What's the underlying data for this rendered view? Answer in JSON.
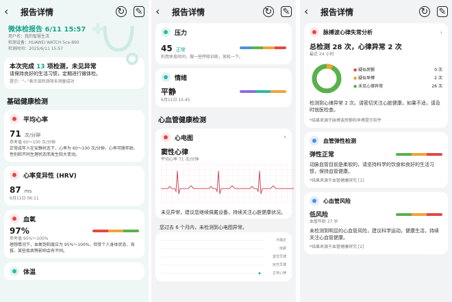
{
  "colors": {
    "accent": "#1aa38c",
    "red": "#e24747",
    "green": "#5ab04c",
    "orange": "#f2a33a",
    "purple": "#8d6be0",
    "blue": "#4a90e2"
  },
  "s1": {
    "title": "报告详情",
    "report_title": "微体检报告 6/11 15:57",
    "meta": [
      "用户名：我的智慧生活",
      "检测设备：HUAWEI WATCH 5ce-890",
      "检测时间：2025/6/11 15:57"
    ],
    "summary_prefix": "本次完成 ",
    "summary_count": "13",
    "summary_suffix": " 项检测，未见异常",
    "summary_sub": "请保持良好的生活习惯，定期进行微体检。",
    "note": "提示：“--”表示该检测项未测量成功",
    "section": "基础健康检测",
    "hr": {
      "label": "平均心率",
      "value": "71",
      "unit": "次/分钟",
      "ref": "参考值 60～100 次/分钟",
      "desc": "正常成年人在安静状态下，心率为 60～100 次/分钟，心率可随年龄、性别和不同生理状态而发生较大变动。"
    },
    "hrv": {
      "label": "心率变异性 (HRV)",
      "value": "87",
      "unit": "ms",
      "time": "6月11日 06:11"
    },
    "spo2": {
      "label": "血氧",
      "value": "97%",
      "ref": "参考值 95%～100%",
      "desc": "理想情况下，血氧饱和度应为 95%～100%，但受个人身体状态、海拔、某些疾病等影响会有不同。"
    },
    "temp": {
      "label": "体温"
    }
  },
  "s2": {
    "title": "报告详情",
    "stress": {
      "label": "压力",
      "value": "45",
      "status": "正常",
      "desc": "利用休息时间，做一些呼吸训练，放松一下。"
    },
    "mood": {
      "label": "情绪",
      "value": "平静",
      "time": "6月11日 15:45"
    },
    "section": "心血管健康检测",
    "ecg": {
      "label": "心电图",
      "result": "窦性心律",
      "hr": "平均心率 71 次/分钟",
      "advice": "未见异常，建议您继续佩戴设备，持续关注心脏健康状况。",
      "history": "您过去 6 个月内，未检测到心电图异常。"
    },
    "legend": [
      "不确定",
      "房颤",
      "室性早搏",
      "房性早搏",
      "正常心律"
    ]
  },
  "s3": {
    "title": "报告详情",
    "pulse": {
      "label": "脉搏波心律失常分析",
      "summary": "总检测 28 次，心律异常 2 次",
      "recent": "最近 24 小时",
      "items": [
        {
          "name": "疑似房颤",
          "count": "0 次"
        },
        {
          "name": "疑似早搏",
          "count": "2 次"
        },
        {
          "name": "未见心律异常",
          "count": "26 次"
        }
      ],
      "advice": "检测到心律异常 2 次。请密切关注心脏健康，如果不适，请及时就医检查。",
      "source": "*结果来源于脉搏波房颤和早搏提示软件"
    },
    "chart_data": {
      "type": "pie",
      "categories": [
        "疑似房颤",
        "疑似早搏",
        "未见心律异常"
      ],
      "values": [
        0,
        2,
        26
      ]
    },
    "elastic": {
      "label": "血管弹性检测",
      "value": "弹性正常",
      "advice": "动脉血管目前是柔软的，请坚持科学的饮食和良好的生活习惯，保持血管健康。",
      "source": "*结果来源于血管健康研究 [1]"
    },
    "risk": {
      "label": "心血管风险",
      "value": "低风险",
      "age": "血管年龄 27 岁",
      "advice": "未检测到明显的心血管风险，建议科学运动，健康生活，持续关注心血管健康。",
      "source": "*结果来源于血管健康研究 [2]"
    }
  }
}
